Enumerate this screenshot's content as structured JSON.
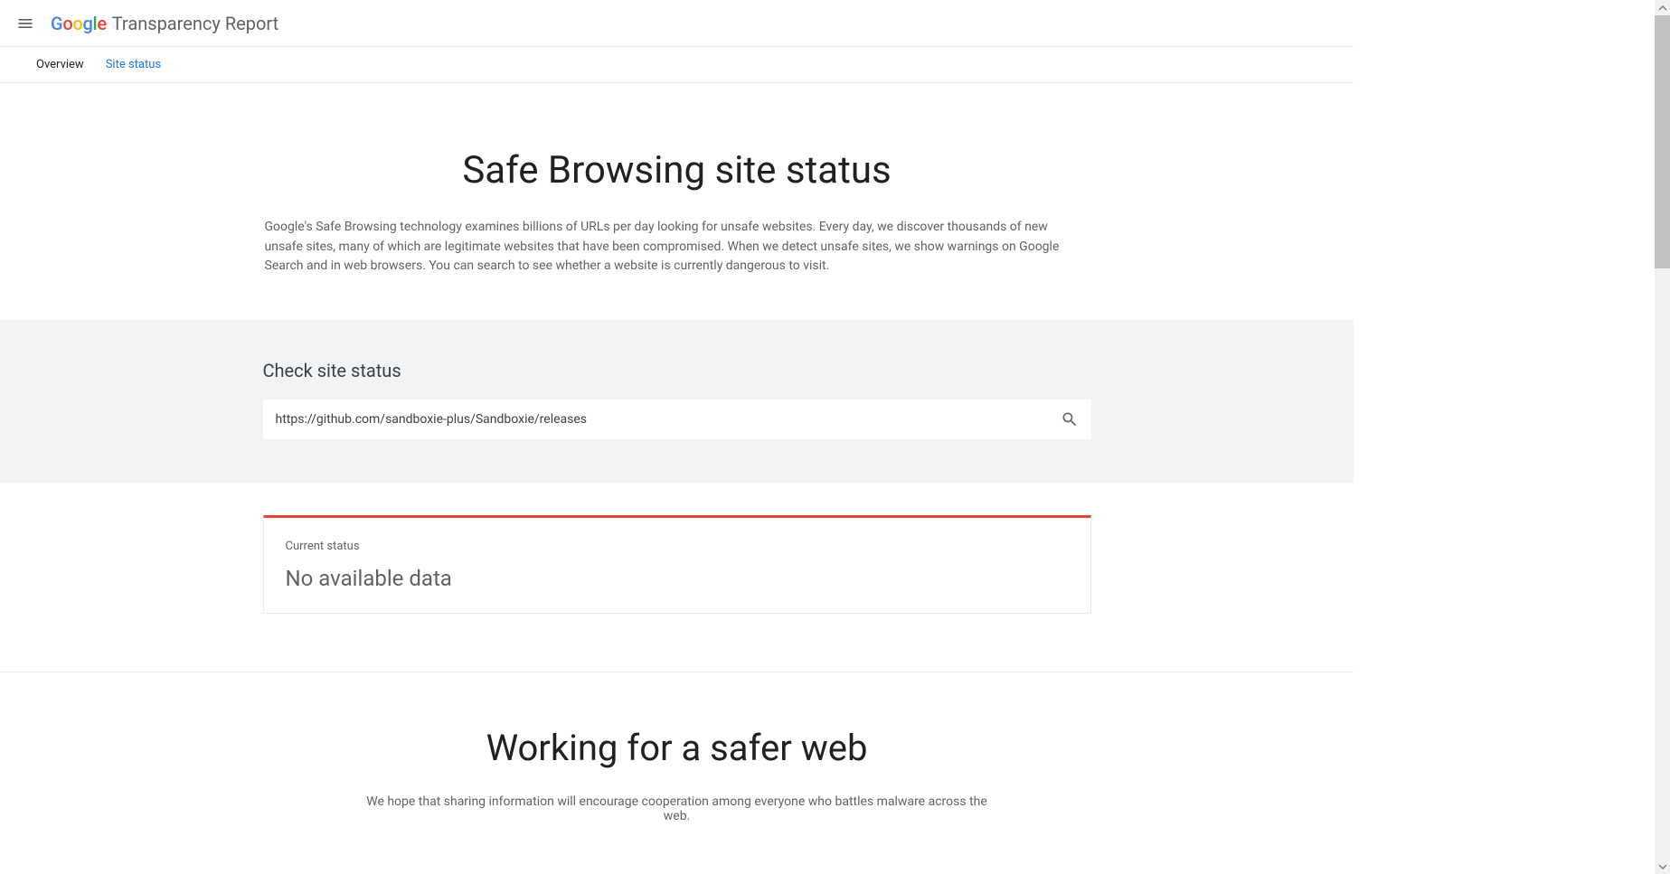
{
  "header": {
    "brand": "Google",
    "title": "Transparency Report"
  },
  "tabs": {
    "overview": "Overview",
    "site_status": "Site status"
  },
  "hero": {
    "title": "Safe Browsing site status",
    "description": "Google's Safe Browsing technology examines billions of URLs per day looking for unsafe websites. Every day, we discover thousands of new unsafe sites, many of which are legitimate websites that have been compromised. When we detect unsafe sites, we show warnings on Google Search and in web browsers. You can search to see whether a website is currently dangerous to visit."
  },
  "check": {
    "title": "Check site status",
    "input_value": "https://github.com/sandboxie-plus/Sandboxie/releases"
  },
  "status": {
    "label": "Current status",
    "value": "No available data"
  },
  "safer": {
    "title": "Working for a safer web",
    "description": "We hope that sharing information will encourage cooperation among everyone who battles malware across the web."
  }
}
